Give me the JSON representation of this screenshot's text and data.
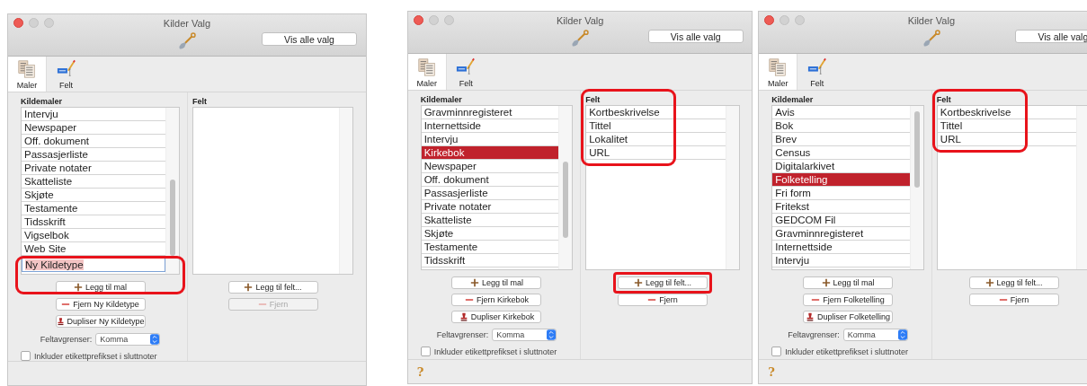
{
  "windows": [
    {
      "title": "Kilder Valg",
      "show_all_button": "Vis alle valg",
      "tabs": [
        {
          "label": "Maler",
          "selected": true
        },
        {
          "label": "Felt",
          "selected": false
        }
      ],
      "templates_label": "Kildemaler",
      "templates": [
        {
          "label": "Intervju",
          "selected": false
        },
        {
          "label": "Newspaper",
          "selected": false
        },
        {
          "label": "Off. dokument",
          "selected": false
        },
        {
          "label": "Passasjerliste",
          "selected": false
        },
        {
          "label": "Private notater",
          "selected": false
        },
        {
          "label": "Skatteliste",
          "selected": false
        },
        {
          "label": "Skjøte",
          "selected": false
        },
        {
          "label": "Testamente",
          "selected": false
        },
        {
          "label": "Tidsskrift",
          "selected": false
        },
        {
          "label": "Vigselbok",
          "selected": false
        },
        {
          "label": "Web Site",
          "selected": false
        }
      ],
      "new_template": "Ny Kildetype",
      "template_buttons": [
        {
          "kind": "add",
          "label": "Legg til mal",
          "disabled": false
        },
        {
          "kind": "remove",
          "label": "Fjern Ny Kildetype",
          "disabled": false
        },
        {
          "kind": "duplicate",
          "label": "Dupliser Ny Kildetype",
          "disabled": false
        }
      ],
      "delimiter": {
        "label": "Feltavgrenser:",
        "value": "Komma"
      },
      "checkbox": {
        "label": "Inkluder etikettprefikset i sluttnoter",
        "checked": false
      },
      "fields_label": "Felt",
      "field_buttons": [
        {
          "kind": "add",
          "label": "Legg til felt...",
          "disabled": false
        },
        {
          "kind": "remove",
          "label": "Fjern",
          "disabled": true
        }
      ],
      "new_template_highlighted": true
    },
    {
      "title": "Kilder Valg",
      "show_all_button": "Vis alle valg",
      "tabs": [
        {
          "label": "Maler",
          "selected": true
        },
        {
          "label": "Felt",
          "selected": false
        }
      ],
      "templates_label": "Kildemaler",
      "templates": [
        {
          "label": "Gravminnregisteret",
          "selected": false
        },
        {
          "label": "Internettside",
          "selected": false
        },
        {
          "label": "Intervju",
          "selected": false
        },
        {
          "label": "Kirkebok",
          "selected": true
        },
        {
          "label": "Newspaper",
          "selected": false
        },
        {
          "label": "Off. dokument",
          "selected": false
        },
        {
          "label": "Passasjerliste",
          "selected": false
        },
        {
          "label": "Private notater",
          "selected": false
        },
        {
          "label": "Skatteliste",
          "selected": false
        },
        {
          "label": "Skjøte",
          "selected": false
        },
        {
          "label": "Testamente",
          "selected": false
        },
        {
          "label": "Tidsskrift",
          "selected": false
        }
      ],
      "template_buttons": [
        {
          "kind": "add",
          "label": "Legg til mal",
          "disabled": false
        },
        {
          "kind": "remove",
          "label": "Fjern Kirkebok",
          "disabled": false
        },
        {
          "kind": "duplicate",
          "label": "Dupliser Kirkebok",
          "disabled": false
        }
      ],
      "delimiter": {
        "label": "Feltavgrenser:",
        "value": "Komma"
      },
      "checkbox": {
        "label": "Inkluder etikettprefikset i sluttnoter",
        "checked": false
      },
      "fields_label": "Felt",
      "fields": [
        "Kortbeskrivelse",
        "Tittel",
        "Lokalitet",
        "URL"
      ],
      "field_buttons": [
        {
          "kind": "add",
          "label": "Legg til felt...",
          "disabled": false,
          "highlighted": true
        },
        {
          "kind": "remove",
          "label": "Fjern",
          "disabled": false,
          "highlighted": false
        }
      ],
      "help": "?",
      "fields_highlighted": true
    },
    {
      "title": "Kilder Valg",
      "show_all_button": "Vis alle valg",
      "tabs": [
        {
          "label": "Maler",
          "selected": true
        },
        {
          "label": "Felt",
          "selected": false
        }
      ],
      "templates_label": "Kildemaler",
      "templates": [
        {
          "label": "Avis",
          "selected": false
        },
        {
          "label": "Bok",
          "selected": false
        },
        {
          "label": "Brev",
          "selected": false
        },
        {
          "label": "Census",
          "selected": false
        },
        {
          "label": "Digitalarkivet",
          "selected": false
        },
        {
          "label": "Folketelling",
          "selected": true
        },
        {
          "label": "Fri form",
          "selected": false
        },
        {
          "label": "Fritekst",
          "selected": false
        },
        {
          "label": "GEDCOM Fil",
          "selected": false
        },
        {
          "label": "Gravminnregisteret",
          "selected": false
        },
        {
          "label": "Internettside",
          "selected": false
        },
        {
          "label": "Intervju",
          "selected": false
        }
      ],
      "template_buttons": [
        {
          "kind": "add",
          "label": "Legg til mal",
          "disabled": false
        },
        {
          "kind": "remove",
          "label": "Fjern Folketelling",
          "disabled": false
        },
        {
          "kind": "duplicate",
          "label": "Dupliser Folketelling",
          "disabled": false
        }
      ],
      "delimiter": {
        "label": "Feltavgrenser:",
        "value": "Komma"
      },
      "checkbox": {
        "label": "Inkluder etikettprefikset i sluttnoter",
        "checked": false
      },
      "fields_label": "Felt",
      "fields": [
        "Kortbeskrivelse",
        "Tittel",
        "URL"
      ],
      "field_buttons": [
        {
          "kind": "add",
          "label": "Legg til felt...",
          "disabled": false
        },
        {
          "kind": "remove",
          "label": "Fjern",
          "disabled": false
        }
      ],
      "help": "?",
      "fields_highlighted": true
    }
  ]
}
